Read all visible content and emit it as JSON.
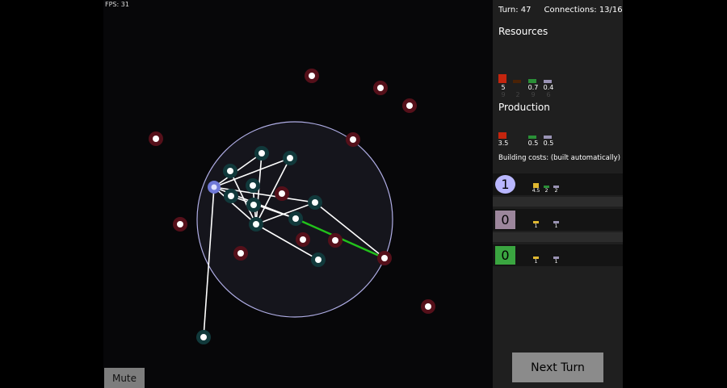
{
  "hud": {
    "fps": "FPS: 31",
    "mute_label": "Mute"
  },
  "status": {
    "turn": "Turn: 47",
    "connections": "Connections: 13/16"
  },
  "resources": {
    "heading": "Resources",
    "items": [
      {
        "value": "5",
        "sub": "9",
        "color": "#c4250e"
      },
      {
        "value": "",
        "sub": "2",
        "color": "#4a2206"
      },
      {
        "value": "0.7",
        "sub": "9",
        "color": "#2a8f37"
      },
      {
        "value": "0.4",
        "sub": "6",
        "color": "#9a93b5"
      }
    ]
  },
  "production": {
    "heading": "Production",
    "items": [
      {
        "value": "3.5",
        "color": "#c4250e"
      },
      {
        "value": "0.5",
        "color": "#2a8f37"
      },
      {
        "value": "0.5",
        "color": "#9a93b5"
      }
    ]
  },
  "building": {
    "caption": "Building costs: (built automatically)",
    "rows": [
      {
        "count": "1",
        "badge_color": "#b9b7ff",
        "badge_text_color": "#000",
        "costs": [
          {
            "v": "4.5",
            "c": "#e0b830"
          },
          {
            "v": "2",
            "c": "#2a8f37"
          },
          {
            "v": "2",
            "c": "#9a93b5"
          }
        ]
      },
      {
        "count": "0",
        "badge_color": "#9c869c",
        "badge_text_color": "#000",
        "costs": [
          {
            "v": "1",
            "c": "#e0b830"
          },
          {
            "v": "1",
            "c": "#9a93b5"
          }
        ]
      },
      {
        "count": "0",
        "badge_color": "#3aa540",
        "badge_text_color": "#000",
        "costs": [
          {
            "v": "1",
            "c": "#e0b830"
          },
          {
            "v": "1",
            "c": "#9a93b5"
          }
        ]
      }
    ]
  },
  "next_turn_label": "Next Turn",
  "colors": {
    "range_fill": "#15151c",
    "range_stroke": "#b0aee6",
    "link": "#ffffff",
    "active_link": "#22c21b",
    "own_node": "#11393b",
    "enemy_node": "#55101a",
    "hub": "#6f79d8"
  }
}
